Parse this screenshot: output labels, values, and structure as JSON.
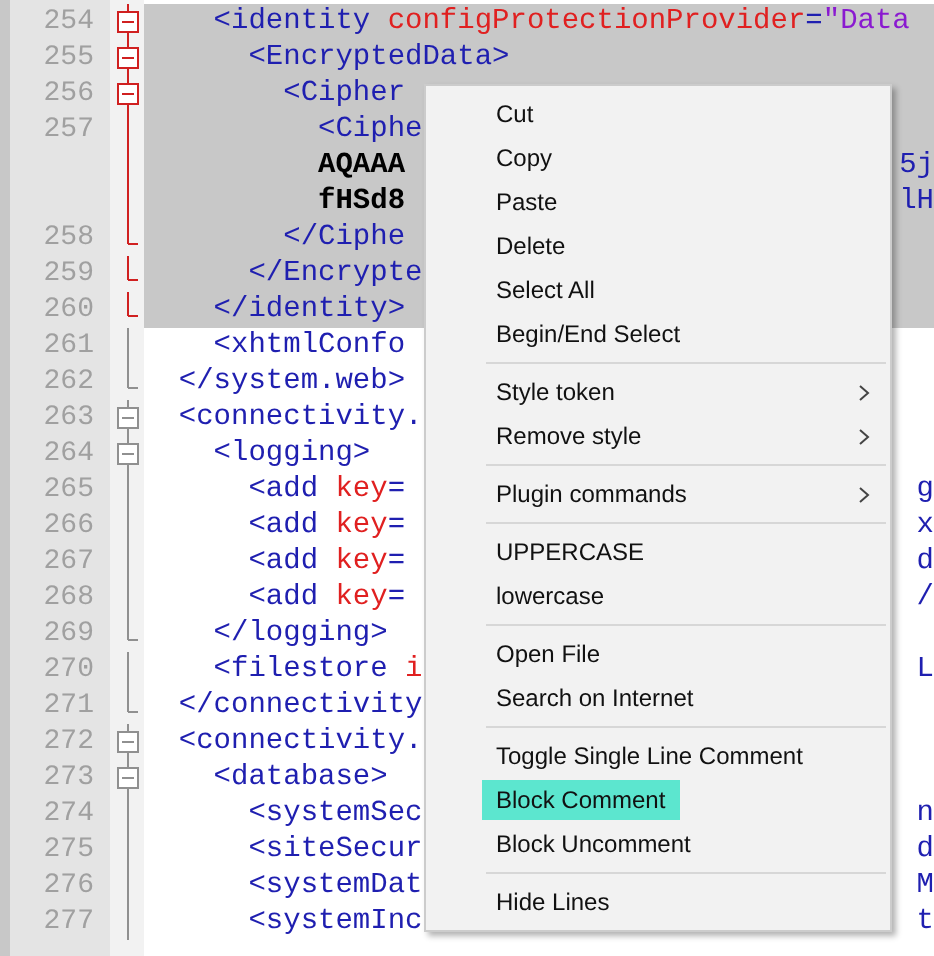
{
  "editor": {
    "lines": [
      {
        "number": "254",
        "kind": "start",
        "selected": true,
        "segments": [
          {
            "kind": "tag",
            "text": "    <identity "
          },
          {
            "kind": "attr",
            "text": "configProtectionProvider"
          },
          {
            "kind": "tag",
            "text": "="
          },
          {
            "kind": "value",
            "text": "\"Data"
          }
        ]
      },
      {
        "number": "255",
        "kind": "start",
        "selected": true,
        "segments": [
          {
            "kind": "tag",
            "text": "      <EncryptedData>"
          }
        ]
      },
      {
        "number": "256",
        "kind": "start",
        "selected": true,
        "segments": [
          {
            "kind": "tag",
            "text": "        <Cipher"
          }
        ]
      },
      {
        "number": "257",
        "kind": "line",
        "selected": true,
        "segments": [
          {
            "kind": "tag",
            "text": "          <Ciphe"
          }
        ]
      },
      {
        "kind": "line",
        "selected": true,
        "segments": [
          {
            "kind": "data",
            "text": "          AQAAA"
          }
        ],
        "tail": "5j"
      },
      {
        "kind": "line",
        "selected": true,
        "segments": [
          {
            "kind": "data",
            "text": "          fHSd8"
          }
        ],
        "tail": "lH"
      },
      {
        "number": "258",
        "kind": "end",
        "selected": true,
        "segments": [
          {
            "kind": "tag",
            "text": "        </Ciphe"
          }
        ]
      },
      {
        "number": "259",
        "kind": "end",
        "selected": true,
        "segments": [
          {
            "kind": "tag",
            "text": "      </Encrypte"
          }
        ]
      },
      {
        "number": "260",
        "kind": "end",
        "selected": true,
        "segments": [
          {
            "kind": "tag",
            "text": "    </identity>"
          }
        ]
      },
      {
        "number": "261",
        "kind": "line",
        "selected": false,
        "segments": [
          {
            "kind": "tag",
            "text": "    <xhtmlConfo"
          }
        ]
      },
      {
        "number": "262",
        "kind": "end",
        "selected": false,
        "segments": [
          {
            "kind": "tag",
            "text": "  </system.web>"
          }
        ]
      },
      {
        "number": "263",
        "kind": "start",
        "selected": false,
        "segments": [
          {
            "kind": "tag",
            "text": "  <connectivity."
          }
        ]
      },
      {
        "number": "264",
        "kind": "start",
        "selected": false,
        "segments": [
          {
            "kind": "tag",
            "text": "    <logging>"
          }
        ]
      },
      {
        "number": "265",
        "kind": "line",
        "selected": false,
        "segments": [
          {
            "kind": "tag",
            "text": "      <add "
          },
          {
            "kind": "attr",
            "text": "key"
          },
          {
            "kind": "tag",
            "text": "="
          }
        ],
        "tail": "g"
      },
      {
        "number": "266",
        "kind": "line",
        "selected": false,
        "segments": [
          {
            "kind": "tag",
            "text": "      <add "
          },
          {
            "kind": "attr",
            "text": "key"
          },
          {
            "kind": "tag",
            "text": "="
          }
        ],
        "tail": "x"
      },
      {
        "number": "267",
        "kind": "line",
        "selected": false,
        "segments": [
          {
            "kind": "tag",
            "text": "      <add "
          },
          {
            "kind": "attr",
            "text": "key"
          },
          {
            "kind": "tag",
            "text": "="
          }
        ],
        "tail": "d"
      },
      {
        "number": "268",
        "kind": "line",
        "selected": false,
        "segments": [
          {
            "kind": "tag",
            "text": "      <add "
          },
          {
            "kind": "attr",
            "text": "key"
          },
          {
            "kind": "tag",
            "text": "="
          }
        ],
        "tail": "/"
      },
      {
        "number": "269",
        "kind": "end",
        "selected": false,
        "segments": [
          {
            "kind": "tag",
            "text": "    </logging>"
          }
        ]
      },
      {
        "number": "270",
        "kind": "line",
        "selected": false,
        "segments": [
          {
            "kind": "tag",
            "text": "    <filestore "
          },
          {
            "kind": "attr",
            "text": "i"
          }
        ],
        "tail": "L"
      },
      {
        "number": "271",
        "kind": "end",
        "selected": false,
        "segments": [
          {
            "kind": "tag",
            "text": "  </connectivity"
          }
        ]
      },
      {
        "number": "272",
        "kind": "start",
        "selected": false,
        "segments": [
          {
            "kind": "tag",
            "text": "  <connectivity."
          }
        ]
      },
      {
        "number": "273",
        "kind": "start",
        "selected": false,
        "segments": [
          {
            "kind": "tag",
            "text": "    <database>"
          }
        ]
      },
      {
        "number": "274",
        "kind": "line",
        "selected": false,
        "segments": [
          {
            "kind": "tag",
            "text": "      <systemSec"
          }
        ],
        "tail": "n"
      },
      {
        "number": "275",
        "kind": "line",
        "selected": false,
        "segments": [
          {
            "kind": "tag",
            "text": "      <siteSecur"
          }
        ],
        "tail": "d"
      },
      {
        "number": "276",
        "kind": "line",
        "selected": false,
        "segments": [
          {
            "kind": "tag",
            "text": "      <systemDat"
          }
        ],
        "tail": "M"
      },
      {
        "number": "277",
        "kind": "line",
        "selected": false,
        "segments": [
          {
            "kind": "tag",
            "text": "      <systemInc"
          }
        ],
        "tail": "t"
      }
    ]
  },
  "context_menu": {
    "groups": [
      [
        {
          "label": "Cut",
          "selected": false,
          "submenu": false
        },
        {
          "label": "Copy",
          "selected": false,
          "submenu": false
        },
        {
          "label": "Paste",
          "selected": false,
          "submenu": false
        },
        {
          "label": "Delete",
          "selected": false,
          "submenu": false
        },
        {
          "label": "Select All",
          "selected": false,
          "submenu": false
        },
        {
          "label": "Begin/End Select",
          "selected": false,
          "submenu": false
        }
      ],
      [
        {
          "label": "Style token",
          "selected": false,
          "submenu": true
        },
        {
          "label": "Remove style",
          "selected": false,
          "submenu": true
        }
      ],
      [
        {
          "label": "Plugin commands",
          "selected": false,
          "submenu": true
        }
      ],
      [
        {
          "label": "UPPERCASE",
          "selected": false,
          "submenu": false
        },
        {
          "label": "lowercase",
          "selected": false,
          "submenu": false
        }
      ],
      [
        {
          "label": "Open File",
          "selected": false,
          "submenu": false
        },
        {
          "label": "Search on Internet",
          "selected": false,
          "submenu": false
        }
      ],
      [
        {
          "label": "Toggle Single Line Comment",
          "selected": false,
          "submenu": false
        },
        {
          "label": "Block Comment",
          "selected": true,
          "submenu": false
        },
        {
          "label": "Block Uncomment",
          "selected": false,
          "submenu": false
        }
      ],
      [
        {
          "label": "Hide Lines",
          "selected": false,
          "submenu": false
        }
      ]
    ]
  }
}
